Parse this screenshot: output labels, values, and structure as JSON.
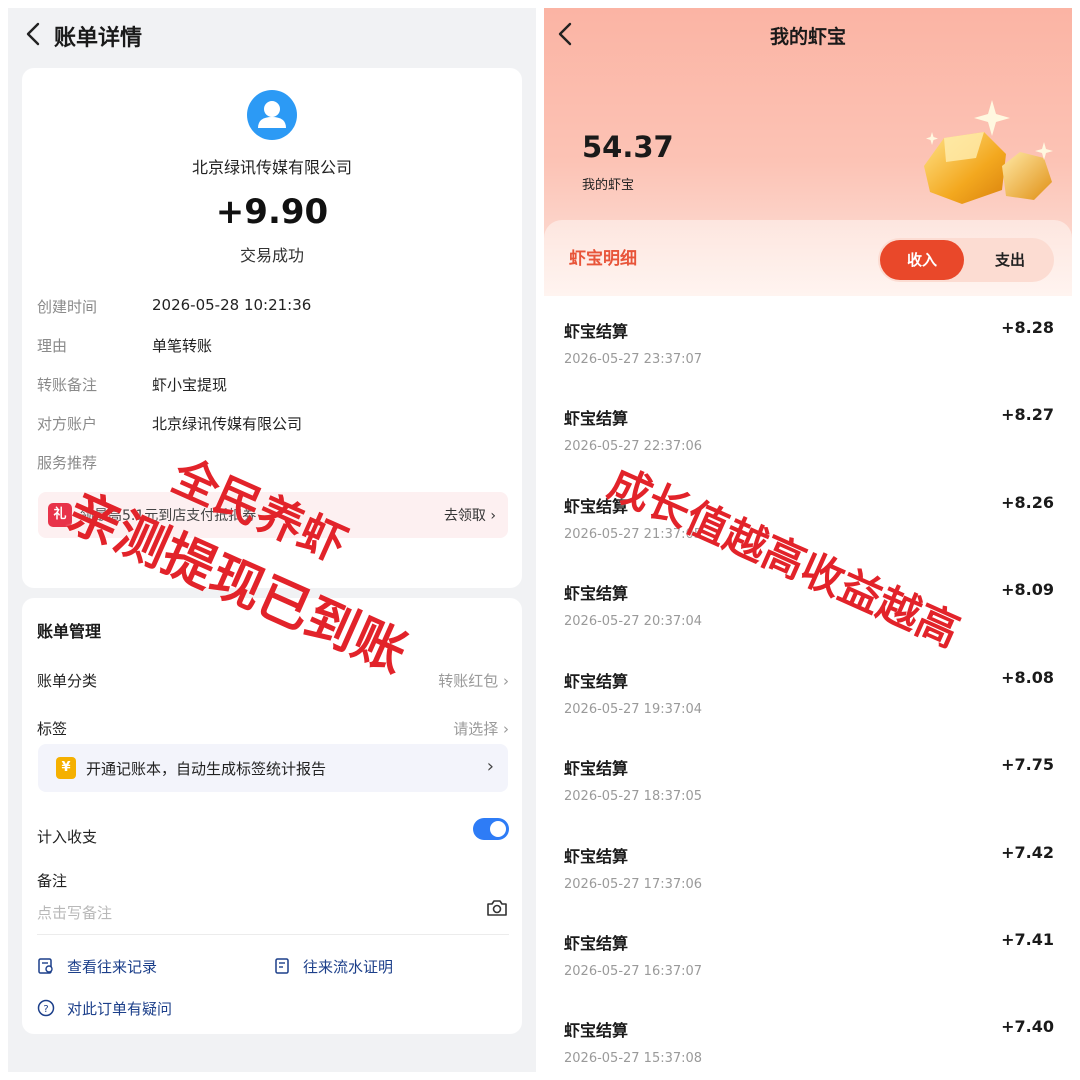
{
  "left": {
    "title": "账单详情",
    "payee": "北京绿讯传媒有限公司",
    "amount": "+9.90",
    "status": "交易成功",
    "details": [
      {
        "key": "创建时间",
        "value": "2026-05-28 10:21:36"
      },
      {
        "key": "理由",
        "value": "单笔转账"
      },
      {
        "key": "转账备注",
        "value": "虾小宝提现"
      },
      {
        "key": "对方账户",
        "value": "北京绿讯传媒有限公司"
      },
      {
        "key": "服务推荐",
        "value": ""
      }
    ],
    "promo": {
      "icon": "礼",
      "text": "领最高5.1元到店支付抵扣券",
      "link": "去领取 ›"
    },
    "manage": {
      "title": "账单管理",
      "category": {
        "label": "账单分类",
        "value": "转账红包 ›"
      },
      "tag": {
        "label": "标签",
        "value": "请选择 ›"
      },
      "ledger": {
        "icon": "¥",
        "text": "开通记账本，自动生成标签统计报告",
        "arrow": "›"
      },
      "count": {
        "label": "计入收支",
        "enabled": true
      },
      "note": {
        "label": "备注",
        "placeholder": "点击写备注"
      },
      "actions": {
        "history": "查看往来记录",
        "proof": "往来流水证明",
        "question": "对此订单有疑问"
      }
    }
  },
  "right": {
    "title": "我的虾宝",
    "balance": "54.37",
    "balance_label": "我的虾宝",
    "tab_title": "虾宝明细",
    "seg": {
      "income": "收入",
      "expense": "支出"
    },
    "records": [
      {
        "name": "虾宝结算",
        "time": "2026-05-27 23:37:07",
        "amount": "+8.28"
      },
      {
        "name": "虾宝结算",
        "time": "2026-05-27 22:37:06",
        "amount": "+8.27"
      },
      {
        "name": "虾宝结算",
        "time": "2026-05-27 21:37:05",
        "amount": "+8.26"
      },
      {
        "name": "虾宝结算",
        "time": "2026-05-27 20:37:04",
        "amount": "+8.09"
      },
      {
        "name": "虾宝结算",
        "time": "2026-05-27 19:37:04",
        "amount": "+8.08"
      },
      {
        "name": "虾宝结算",
        "time": "2026-05-27 18:37:05",
        "amount": "+7.75"
      },
      {
        "name": "虾宝结算",
        "time": "2026-05-27 17:37:06",
        "amount": "+7.42"
      },
      {
        "name": "虾宝结算",
        "time": "2026-05-27 16:37:07",
        "amount": "+7.41"
      },
      {
        "name": "虾宝结算",
        "time": "2026-05-27 15:37:08",
        "amount": "+7.40"
      }
    ]
  },
  "watermarks": {
    "line1": "全民养虾",
    "line2": "亲测提现已到账",
    "line3": "成长值越高收益越高"
  },
  "colors": {
    "accent_blue": "#2e7cf6",
    "accent_red": "#e9482a",
    "watermark_red": "#e2232a"
  }
}
